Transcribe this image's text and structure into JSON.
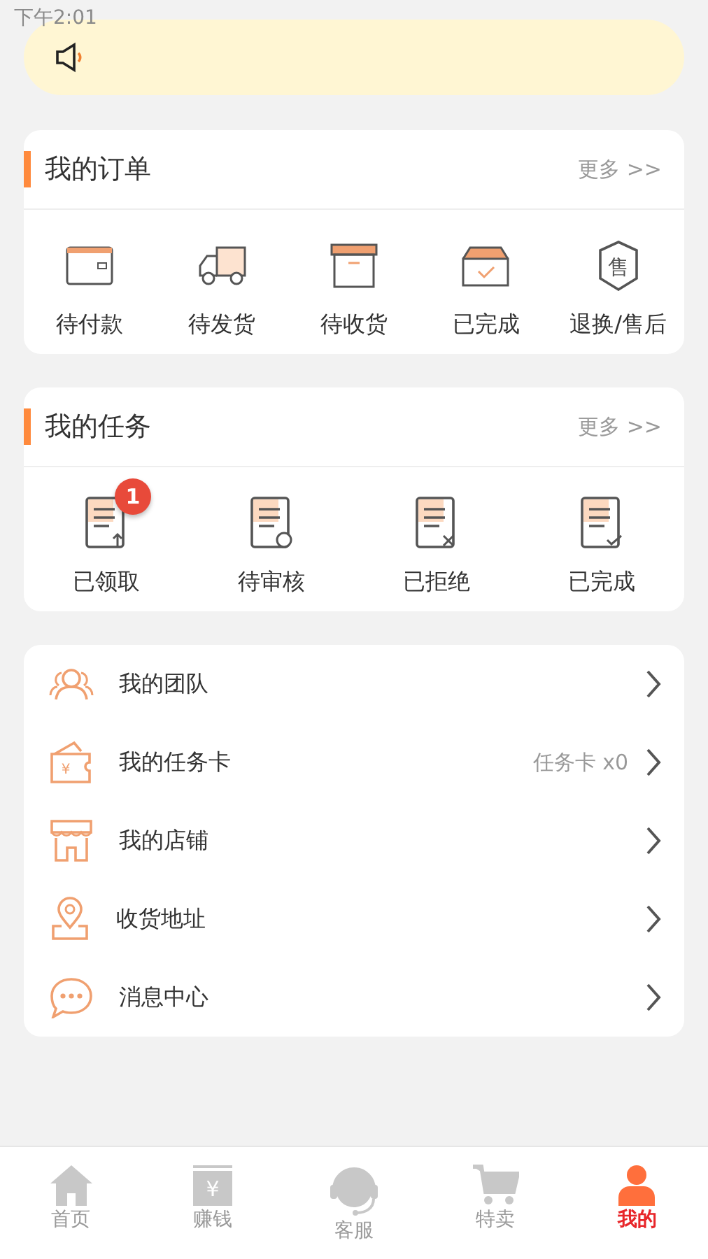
{
  "status_bar": {
    "time": "下午2:01"
  },
  "orders": {
    "title": "我的订单",
    "more": "更多 >>",
    "items": [
      {
        "label": "待付款"
      },
      {
        "label": "待发货"
      },
      {
        "label": "待收货"
      },
      {
        "label": "已完成"
      },
      {
        "label": "退换/售后",
        "icon_text": "售"
      }
    ]
  },
  "tasks": {
    "title": "我的任务",
    "more": "更多 >>",
    "items": [
      {
        "label": "已领取",
        "badge": "1"
      },
      {
        "label": "待审核"
      },
      {
        "label": "已拒绝"
      },
      {
        "label": "已完成"
      }
    ]
  },
  "menu": [
    {
      "label": "我的团队"
    },
    {
      "label": "我的任务卡",
      "value": "任务卡 x0",
      "icon_text": "¥"
    },
    {
      "label": "我的店铺"
    },
    {
      "label": "收货地址"
    },
    {
      "label": "消息中心"
    }
  ],
  "tab_bar": [
    {
      "label": "首页",
      "selected": false
    },
    {
      "label": "赚钱",
      "selected": false,
      "icon_text": "¥"
    },
    {
      "label": "客服",
      "selected": false
    },
    {
      "label": "特卖",
      "selected": false
    },
    {
      "label": "我的",
      "selected": true
    }
  ]
}
